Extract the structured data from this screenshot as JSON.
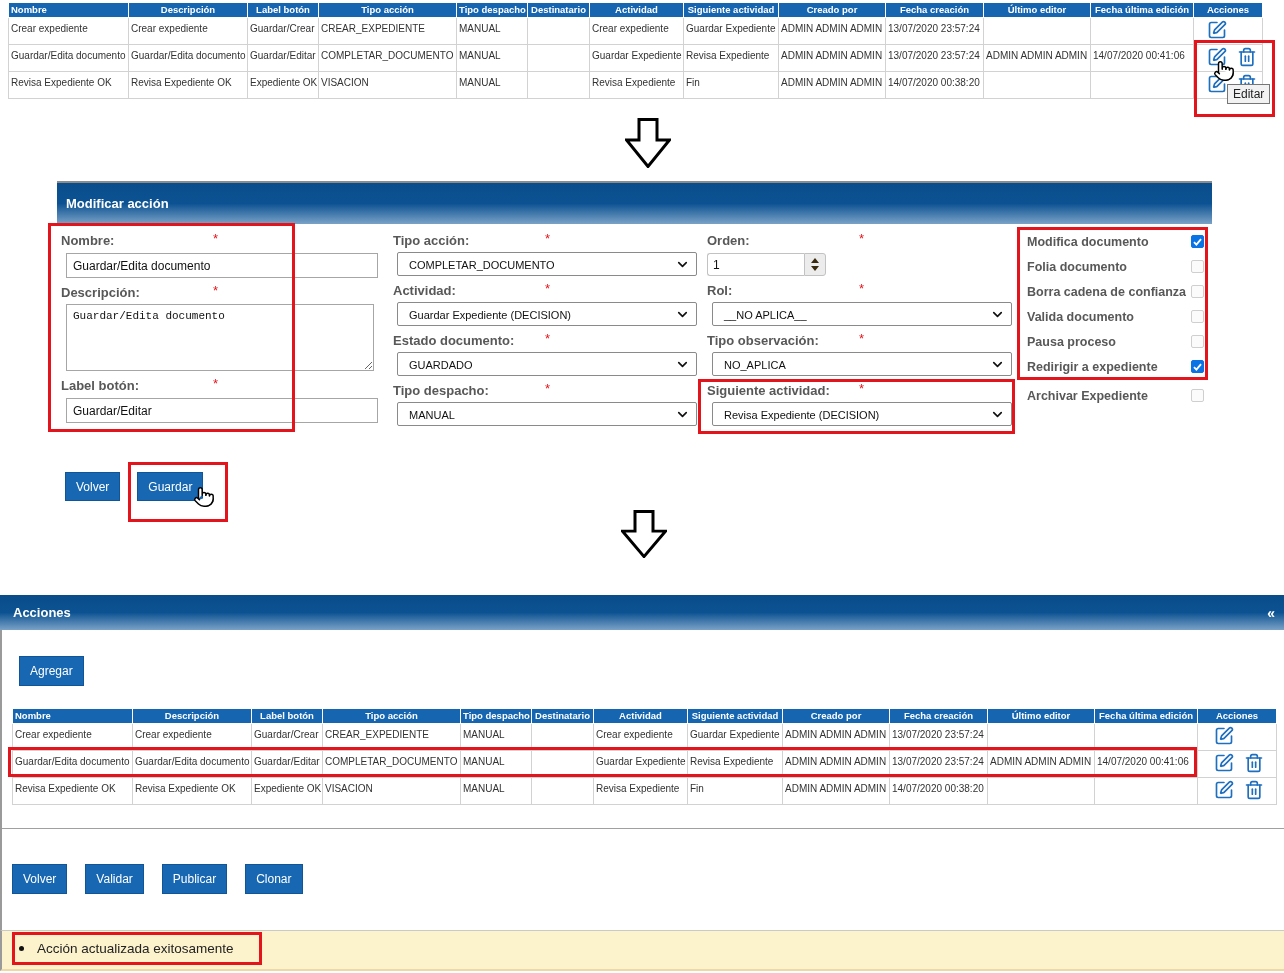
{
  "step_1": {
    "table": {
      "columns": [
        "Nombre",
        "Descripción",
        "Label botón",
        "Tipo acción",
        "Tipo despacho",
        "Destinatario",
        "Actividad",
        "Siguiente actividad",
        "Creado por",
        "Fecha creación",
        "Último editor",
        "Fecha última edición",
        "Acciones"
      ],
      "rows": [
        {
          "cells": [
            "Crear expediente",
            "Crear expediente",
            "Guardar/Crear",
            "CREAR_EXPEDIENTE",
            "MANUAL",
            null,
            "Crear expediente",
            "Guardar Expediente",
            "ADMIN ADMIN ADMIN",
            "13/07/2020 23:57:24",
            null,
            null
          ],
          "actions_highlighted": false,
          "actions": [
            {
              "kind": "edit",
              "hovered": false
            }
          ]
        },
        {
          "cells": [
            "Guardar/Edita documento",
            "Guardar/Edita documento",
            "Guardar/Editar",
            "COMPLETAR_DOCUMENTO",
            "MANUAL",
            null,
            "Guardar Expediente",
            "Revisa Expediente",
            "ADMIN ADMIN ADMIN",
            "13/07/2020 23:57:24",
            "ADMIN ADMIN ADMIN",
            "14/07/2020 00:41:06"
          ],
          "actions_highlighted": true,
          "actions": [
            {
              "kind": "edit",
              "hovered": true,
              "tooltip": "Editar"
            },
            {
              "kind": "delete",
              "hovered": false
            }
          ]
        },
        {
          "cells": [
            "Revisa Expediente OK",
            "Revisa Expediente OK",
            "Expediente OK",
            "VISACION",
            "MANUAL",
            null,
            "Revisa Expediente",
            "Fin",
            "ADMIN ADMIN ADMIN",
            "14/07/2020 00:38:20",
            null,
            null
          ],
          "actions_highlighted": true,
          "actions": [
            {
              "kind": "edit",
              "hovered": false
            },
            {
              "kind": "delete",
              "hovered": false
            }
          ]
        }
      ]
    }
  },
  "modal": {
    "title": "Modificar acción",
    "form": {
      "columns": [
        {
          "groups": [
            {
              "highlighted": true,
              "fields": [
                {
                  "kind": "text",
                  "label": "Nombre:",
                  "required_mark": "*",
                  "value": "Guardar/Edita documento"
                },
                {
                  "kind": "textarea",
                  "label": "Descripción:",
                  "required_mark": "*",
                  "value": "Guardar/Edita documento"
                },
                {
                  "kind": "text",
                  "label": "Label botón:",
                  "required_mark": "*",
                  "value": "Guardar/Editar"
                }
              ]
            }
          ]
        },
        {
          "groups": [
            {
              "highlighted": false,
              "fields": [
                {
                  "kind": "select",
                  "label": "Tipo acción:",
                  "required_mark": "*",
                  "value": "COMPLETAR_DOCUMENTO"
                },
                {
                  "kind": "select",
                  "label": "Actividad:",
                  "required_mark": "*",
                  "value": "Guardar Expediente (DECISION)"
                },
                {
                  "kind": "select",
                  "label": "Estado documento:",
                  "required_mark": "*",
                  "value": "GUARDADO"
                },
                {
                  "kind": "select",
                  "label": "Tipo despacho:",
                  "required_mark": "*",
                  "value": "MANUAL"
                }
              ]
            }
          ]
        },
        {
          "groups": [
            {
              "highlighted": false,
              "fields": [
                {
                  "kind": "number",
                  "label": "Orden:",
                  "required_mark": "*",
                  "value": "1"
                },
                {
                  "kind": "select",
                  "label": "Rol:",
                  "required_mark": "*",
                  "value": "__NO APLICA__"
                },
                {
                  "kind": "select",
                  "label": "Tipo observación:",
                  "required_mark": "*",
                  "value": "NO_APLICA"
                }
              ]
            },
            {
              "highlighted": true,
              "fields": [
                {
                  "kind": "select",
                  "label": "Siguiente actividad:",
                  "required_mark": "*",
                  "value": "Revisa Expediente (DECISION)"
                }
              ]
            }
          ]
        },
        {
          "groups": [
            {
              "highlighted": true,
              "fields": [
                {
                  "kind": "checkbox",
                  "label": "Modifica documento",
                  "checked": true
                },
                {
                  "kind": "checkbox",
                  "label": "Folia documento",
                  "checked": false
                },
                {
                  "kind": "checkbox",
                  "label": "Borra cadena de confianza",
                  "checked": false
                },
                {
                  "kind": "checkbox",
                  "label": "Valida documento",
                  "checked": false
                },
                {
                  "kind": "checkbox",
                  "label": "Pausa proceso",
                  "checked": false
                },
                {
                  "kind": "checkbox",
                  "label": "Redirigir a expediente",
                  "checked": true
                }
              ]
            },
            {
              "highlighted": false,
              "fields": [
                {
                  "kind": "checkbox",
                  "label": "Archivar Expediente",
                  "checked": false
                }
              ]
            }
          ]
        }
      ]
    },
    "buttons": [
      {
        "label": "Volver",
        "highlighted": false,
        "hovered": false
      },
      {
        "label": "Guardar",
        "highlighted": true,
        "hovered": true
      }
    ]
  },
  "panel": {
    "title": "Acciones",
    "collapse_label": "«",
    "add_button": "Agregar",
    "table": {
      "columns": [
        "Nombre",
        "Descripción",
        "Label botón",
        "Tipo acción",
        "Tipo despacho",
        "Destinatario",
        "Actividad",
        "Siguiente actividad",
        "Creado por",
        "Fecha creación",
        "Último editor",
        "Fecha última edición",
        "Acciones"
      ],
      "rows": [
        {
          "cells": [
            "Crear expediente",
            "Crear expediente",
            "Guardar/Crear",
            "CREAR_EXPEDIENTE",
            "MANUAL",
            null,
            "Crear expediente",
            "Guardar Expediente",
            "ADMIN ADMIN ADMIN",
            "13/07/2020 23:57:24",
            null,
            null
          ],
          "highlighted": false,
          "actions": [
            {
              "kind": "edit"
            }
          ]
        },
        {
          "cells": [
            "Guardar/Edita documento",
            "Guardar/Edita documento",
            "Guardar/Editar",
            "COMPLETAR_DOCUMENTO",
            "MANUAL",
            null,
            "Guardar Expediente",
            "Revisa Expediente",
            "ADMIN ADMIN ADMIN",
            "13/07/2020 23:57:24",
            "ADMIN ADMIN ADMIN",
            "14/07/2020 00:41:06"
          ],
          "highlighted": true,
          "actions": [
            {
              "kind": "edit"
            },
            {
              "kind": "delete"
            }
          ]
        },
        {
          "cells": [
            "Revisa Expediente OK",
            "Revisa Expediente OK",
            "Expediente OK",
            "VISACION",
            "MANUAL",
            null,
            "Revisa Expediente",
            "Fin",
            "ADMIN ADMIN ADMIN",
            "14/07/2020 00:38:20",
            null,
            null
          ],
          "highlighted": false,
          "actions": [
            {
              "kind": "edit"
            },
            {
              "kind": "delete"
            }
          ]
        }
      ]
    },
    "buttons": [
      {
        "label": "Volver"
      },
      {
        "label": "Validar"
      },
      {
        "label": "Publicar"
      },
      {
        "label": "Clonar"
      }
    ],
    "messages": [
      {
        "text": "Acción actualizada exitosamente",
        "highlighted": true
      }
    ]
  }
}
